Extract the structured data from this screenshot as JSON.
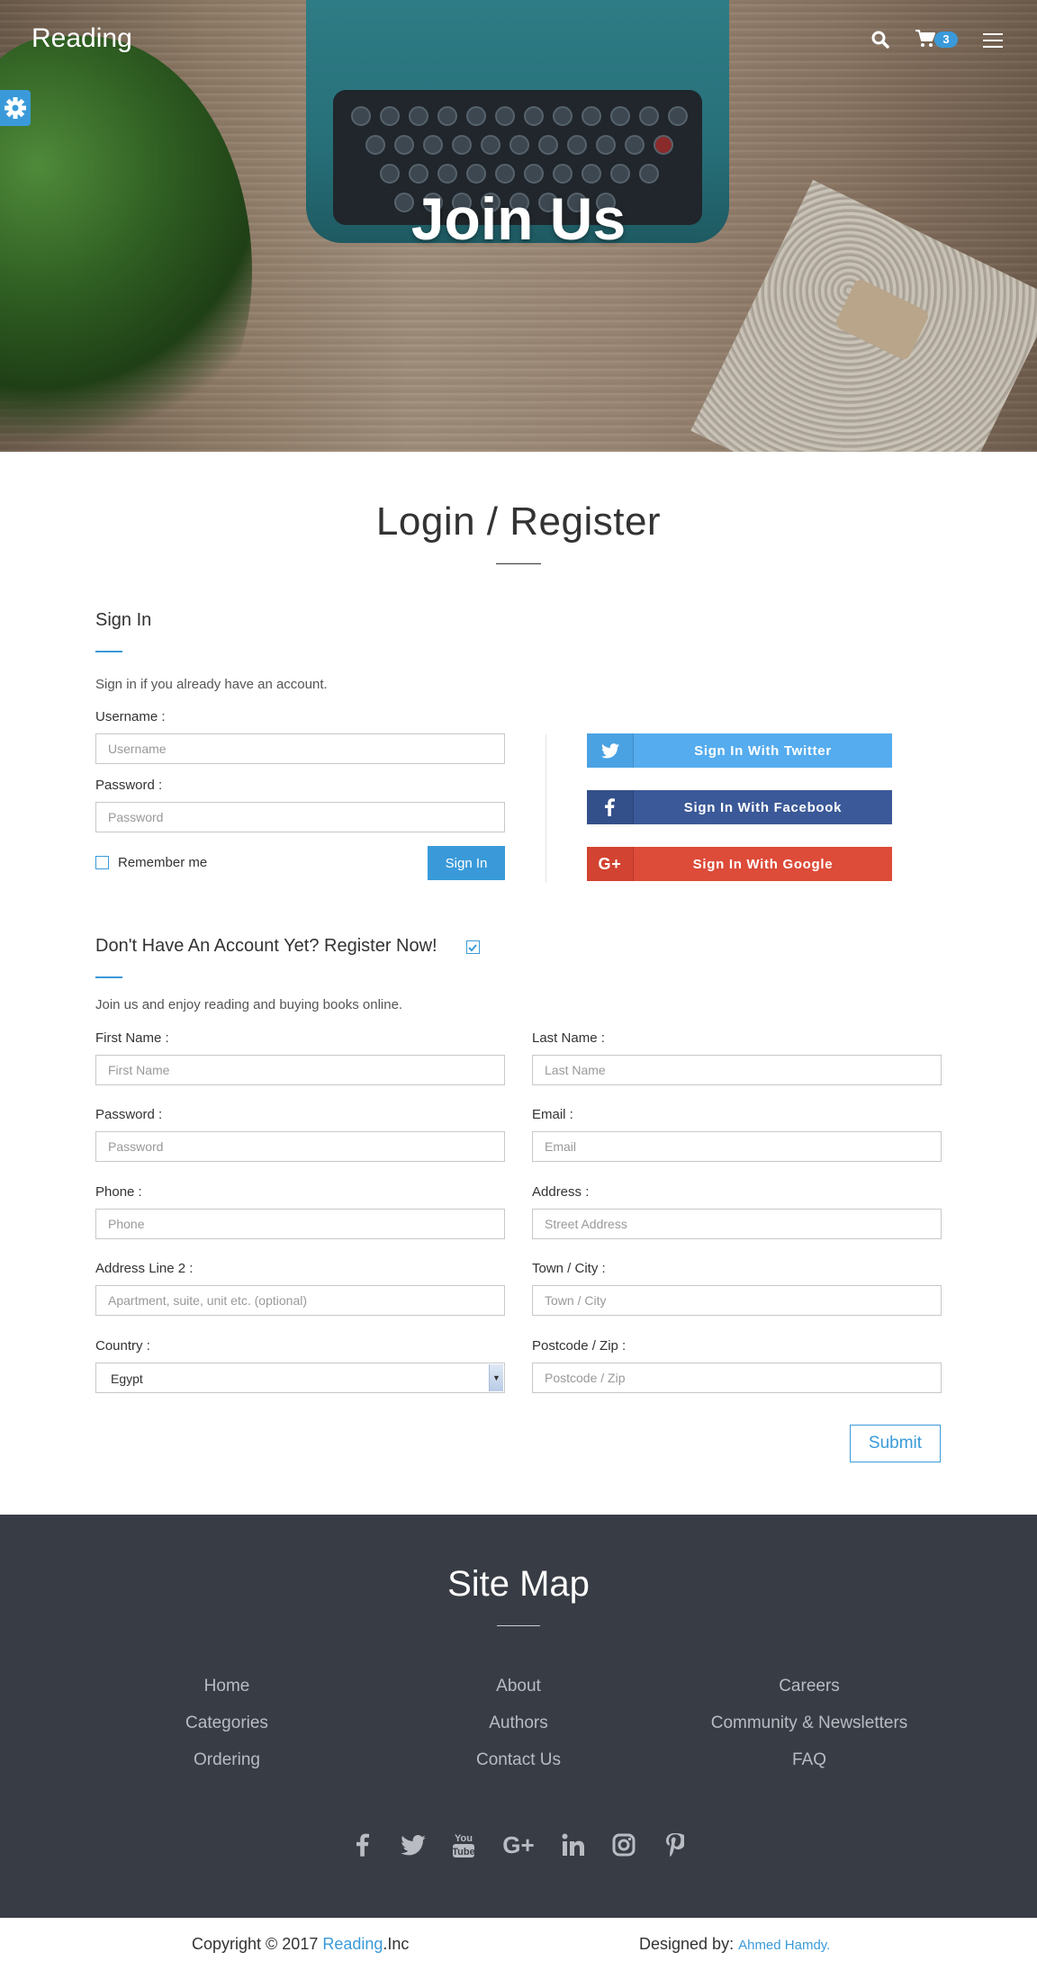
{
  "navbar": {
    "brand": "Reading",
    "cart_count": "3"
  },
  "hero": {
    "title": "Join Us"
  },
  "page_title": "Login / Register",
  "signin": {
    "heading": "Sign In",
    "description": "Sign in if you already have an account.",
    "username_label": "Username :",
    "username_placeholder": "Username",
    "password_label": "Password :",
    "password_placeholder": "Password",
    "remember_label": "Remember me",
    "button": "Sign In",
    "social": {
      "twitter": "Sign In With Twitter",
      "facebook": "Sign In With Facebook",
      "google": "Sign In With Google"
    }
  },
  "register": {
    "heading": "Don't Have An Account Yet? Register Now!",
    "description": "Join us and enjoy reading and buying books online.",
    "fields": {
      "first_name_label": "First Name :",
      "first_name_placeholder": "First Name",
      "last_name_label": "Last Name :",
      "last_name_placeholder": "Last Name",
      "password_label": "Password :",
      "password_placeholder": "Password",
      "email_label": "Email :",
      "email_placeholder": "Email",
      "phone_label": "Phone :",
      "phone_placeholder": "Phone",
      "address_label": "Address :",
      "address_placeholder": "Street Address",
      "address2_label": "Address Line 2 :",
      "address2_placeholder": "Apartment, suite, unit etc. (optional)",
      "city_label": "Town / City :",
      "city_placeholder": "Town / City",
      "country_label": "Country :",
      "country_value": "Egypt",
      "postcode_label": "Postcode / Zip :",
      "postcode_placeholder": "Postcode / Zip"
    },
    "submit": "Submit"
  },
  "footer": {
    "title": "Site Map",
    "links": {
      "home": "Home",
      "about": "About",
      "careers": "Careers",
      "categories": "Categories",
      "authors": "Authors",
      "community": "Community & Newsletters",
      "ordering": "Ordering",
      "contact": "Contact Us",
      "faq": "FAQ"
    },
    "social_icons": [
      "facebook-icon",
      "twitter-icon",
      "youtube-icon",
      "google-plus-icon",
      "linkedin-icon",
      "instagram-icon",
      "pinterest-icon"
    ],
    "copyright_prefix": "Copyright © 2017",
    "copyright_brand": "Reading",
    "copyright_suffix": ".Inc",
    "designed_by_label": "Designed by:",
    "designer_name": "Ahmed Hamdy."
  },
  "colors": {
    "accent": "#3a9ad9",
    "twitter": "#55acee",
    "facebook": "#3b5998",
    "google": "#dd4b39",
    "footer_bg": "#383c45"
  }
}
